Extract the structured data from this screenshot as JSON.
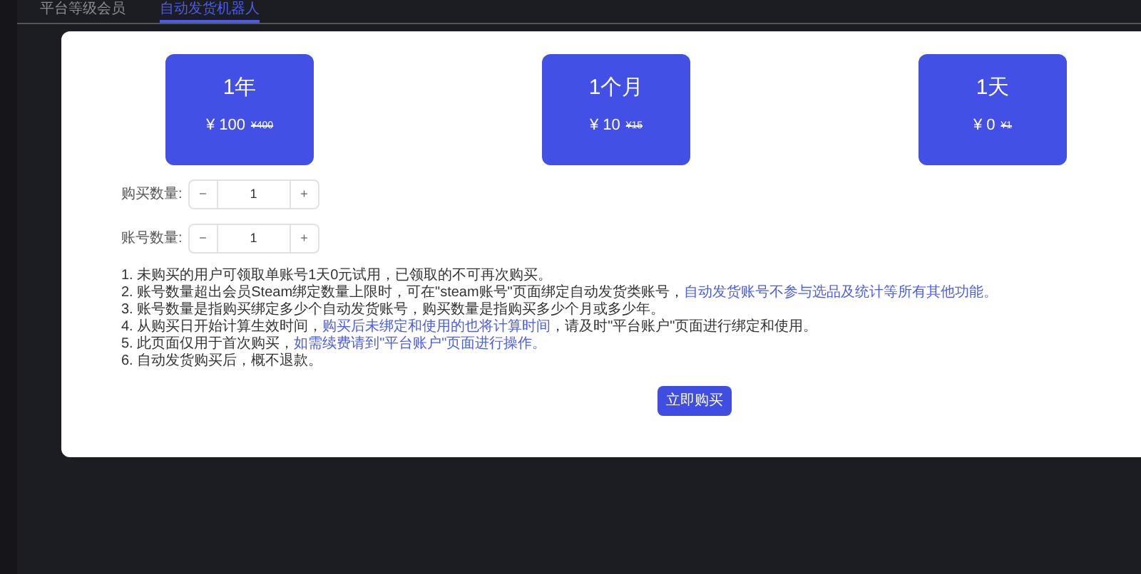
{
  "tabs": [
    {
      "label": "平台等级会员",
      "selected": false
    },
    {
      "label": "自动发货机器人",
      "selected": true
    }
  ],
  "plans": [
    {
      "title": "1年",
      "price": "¥ 100",
      "original_price": "¥400"
    },
    {
      "title": "1个月",
      "price": "¥ 10",
      "original_price": "¥15"
    },
    {
      "title": "1天",
      "price": "¥ 0",
      "original_price": "¥1"
    }
  ],
  "steppers": [
    {
      "label": "购买数量:",
      "minus": "−",
      "value": "1",
      "plus": "+"
    },
    {
      "label": "账号数量:",
      "minus": "−",
      "value": "1",
      "plus": "+"
    }
  ],
  "notes": [
    [
      {
        "kind": "plain",
        "text": "1. 未购买的用户可领取单账号1天0元试用，已领取的不可再次购买。"
      }
    ],
    [
      {
        "kind": "plain",
        "text": "2. 账号数量超出会员Steam绑定数量上限时，可在\"steam账号\"页面绑定自动发货类账号，"
      },
      {
        "kind": "highlight",
        "text": "自动发货账号不参与选品及统计等所有其他功能。"
      }
    ],
    [
      {
        "kind": "plain",
        "text": "3. 账号数量是指购买绑定多少个自动发货账号，购买数量是指购买多少个月或多少年。"
      }
    ],
    [
      {
        "kind": "plain",
        "text": "4. 从购买日开始计算生效时间，"
      },
      {
        "kind": "highlight",
        "text": "购买后未绑定和使用的也将计算时间"
      },
      {
        "kind": "plain",
        "text": "，请及时\"平台账户\"页面进行绑定和使用。"
      }
    ],
    [
      {
        "kind": "plain",
        "text": "5. 此页面仅用于首次购买，"
      },
      {
        "kind": "highlight",
        "text": "如需续费请到\"平台账户\"页面进行操作。"
      }
    ],
    [
      {
        "kind": "plain",
        "text": "6. 自动发货购买后，概不退款。"
      }
    ]
  ],
  "buy_button": "立即购买"
}
